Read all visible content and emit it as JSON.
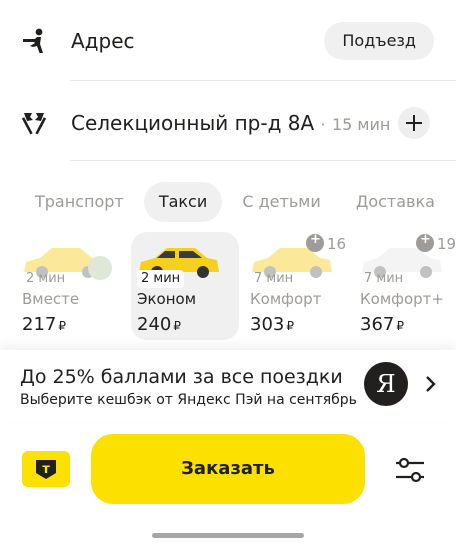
{
  "route": {
    "from": {
      "label": "Адрес",
      "entrance_label": "Подъезд"
    },
    "to": {
      "address": "Селекционный пр-д 8А",
      "separator": "·",
      "eta": "15 мин"
    }
  },
  "tabs": [
    {
      "label": "Транспорт",
      "active": false
    },
    {
      "label": "Такси",
      "active": true
    },
    {
      "label": "С детьми",
      "active": false
    },
    {
      "label": "Доставка",
      "active": false
    }
  ],
  "tariffs": [
    {
      "pickup": "2 мин",
      "name": "Вместе",
      "price": "217",
      "currency": "₽",
      "selected": false
    },
    {
      "pickup": "2 мин",
      "name": "Эконом",
      "price": "240",
      "currency": "₽",
      "selected": true
    },
    {
      "pickup": "7 мин",
      "name": "Комфорт",
      "price": "303",
      "currency": "₽",
      "promo": "16",
      "selected": false
    },
    {
      "pickup": "7 мин",
      "name": "Комфорт+",
      "price": "367",
      "currency": "₽",
      "promo": "19",
      "selected": false
    }
  ],
  "promo": {
    "title": "До 25% баллами за все поездки",
    "subtitle": "Выберите кешбэк от Яндекс Пэй на сентябрь",
    "logo_letter": "Я"
  },
  "actions": {
    "order_label": "Заказать",
    "pay_letter": "т"
  },
  "colors": {
    "accent": "#fce000",
    "text": "#21201f",
    "muted": "#9e9b98",
    "chip": "#f0f0f0",
    "car_yellow": "#f7cf1f"
  },
  "icons": {
    "from": "walking-person-icon",
    "to": "flags-icon",
    "add": "plus-icon",
    "settings": "sliders-icon",
    "chevron": "chevron-right-icon",
    "payment": "card-icon"
  }
}
